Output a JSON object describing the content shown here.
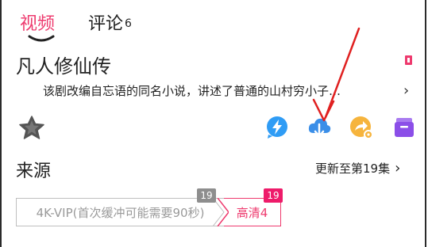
{
  "tabs": {
    "video_label": "视频",
    "comments_label": "评论",
    "comments_count": "6"
  },
  "show": {
    "title": "凡人修仙传",
    "description": "该剧改编自忘语的同名小说，讲述了普通的山村穷小子…"
  },
  "actions": [
    {
      "icon": "star-icon",
      "color": "#555555"
    },
    {
      "icon": "lightning-bubble-icon",
      "color": "#2f9cf5"
    },
    {
      "icon": "cloud-download-icon",
      "color": "#3a8ee8"
    },
    {
      "icon": "share-gear-icon",
      "color": "#f6b43d"
    },
    {
      "icon": "inbox-icon",
      "color": "#8b4ee8"
    }
  ],
  "sources": {
    "section_title": "来源",
    "update_text": "更新至第19集",
    "items": [
      {
        "label": "4K-VIP(首次缓冲可能需要90秒)",
        "badge": "19",
        "selected": false
      },
      {
        "label": "高清4",
        "badge": "19",
        "selected": true
      }
    ]
  },
  "colors": {
    "accent": "#ee3a6e",
    "annotation": "#e02020"
  }
}
